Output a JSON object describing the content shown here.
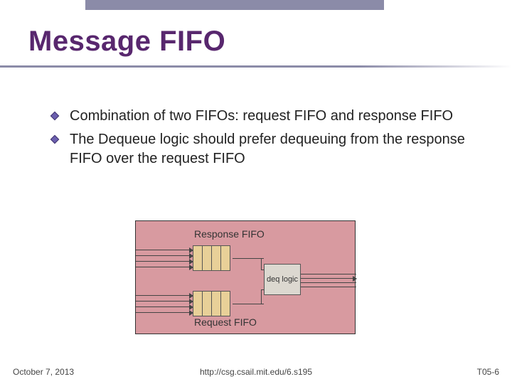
{
  "title": "Message FIFO",
  "bullets": [
    "Combination of two FIFOs: request FIFO and response FIFO",
    "The Dequeue logic should prefer dequeuing from the response FIFO over the request FIFO"
  ],
  "diagram": {
    "response_label": "Response FIFO",
    "request_label": "Request FIFO",
    "deq_label": "deq logic"
  },
  "footer": {
    "date": "October 7, 2013",
    "url": "http://csg.csail.mit.edu/6.s195",
    "page": "T05-6"
  },
  "colors": {
    "title": "#58276e",
    "accent": "#8b8ba8",
    "container": "#d89aa0",
    "cell": "#e8d098",
    "deq": "#dcd8d0"
  }
}
